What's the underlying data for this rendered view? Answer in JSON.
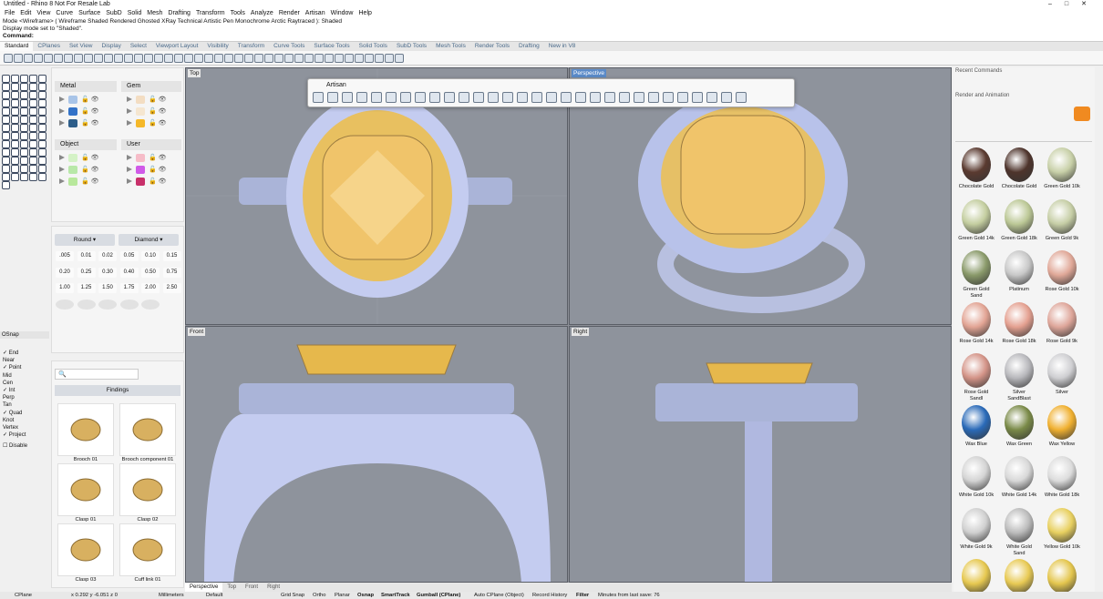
{
  "window": {
    "title": "Untitled - Rhino 8 Not For Resale Lab"
  },
  "menu": [
    "File",
    "Edit",
    "View",
    "Curve",
    "Surface",
    "SubD",
    "Solid",
    "Mesh",
    "Drafting",
    "Transform",
    "Tools",
    "Analyze",
    "Render",
    "Artisan",
    "Window",
    "Help"
  ],
  "command": {
    "line1": "Mode <Wireframe> ( Wireframe  Shaded  Rendered  Ghosted  XRay  Technical  Artistic  Pen  Monochrome  Arctic  Raytraced ): Shaded",
    "line2": "Display mode set to \"Shaded\".",
    "prompt": "Command:"
  },
  "tabs": [
    "Standard",
    "CPlanes",
    "Set View",
    "Display",
    "Select",
    "Viewport Layout",
    "Visibility",
    "Transform",
    "Curve Tools",
    "Surface Tools",
    "Solid Tools",
    "SubD Tools",
    "Mesh Tools",
    "Render Tools",
    "Drafting",
    "New in V8"
  ],
  "metal": {
    "label": "Metal",
    "colors": [
      "#a8c4e8",
      "#3272c8",
      "#2e5e8a"
    ]
  },
  "gem": {
    "label": "Gem",
    "colors": [
      "#f3ddc2",
      "#f5e6d0",
      "#f5b829"
    ]
  },
  "object": {
    "label": "Object",
    "colors": [
      "#d4f2c6",
      "#b8e8a8",
      "#b8e89c"
    ]
  },
  "user": {
    "label": "User",
    "colors": [
      "#f6bcc8",
      "#d05ae8",
      "#c8306a"
    ]
  },
  "shape": {
    "cut": "Round",
    "setting": "Diamond"
  },
  "sizes": [
    ".005",
    "0.01",
    "0.02",
    "0.05",
    "0.10",
    "0.15",
    "0.20",
    "0.25",
    "0.30",
    "0.40",
    "0.50",
    "0.75",
    "1.00",
    "1.25",
    "1.50",
    "1.75",
    "2.00",
    "2.50"
  ],
  "osnap": {
    "title": "OSnap",
    "items": [
      {
        "label": "End",
        "on": true
      },
      {
        "label": "Near",
        "on": false
      },
      {
        "label": "Point",
        "on": true
      },
      {
        "label": "Mid",
        "on": false
      },
      {
        "label": "Cen",
        "on": false
      },
      {
        "label": "Int",
        "on": true
      },
      {
        "label": "Perp",
        "on": false
      },
      {
        "label": "Tan",
        "on": false
      },
      {
        "label": "Quad",
        "on": true
      },
      {
        "label": "Knot",
        "on": false
      },
      {
        "label": "Vertex",
        "on": false
      },
      {
        "label": "Project",
        "on": true
      }
    ],
    "disable": "Disable"
  },
  "findings": {
    "header": "Findings",
    "items": [
      "Brooch 01",
      "Brooch component 01",
      "Clasp 01",
      "Clasp 02",
      "Clasp 03",
      "Cuff link 01"
    ]
  },
  "viewports": {
    "top": "Top",
    "perspective": "Perspective",
    "front": "Front",
    "right": "Right"
  },
  "artisan": {
    "title": "Artisan"
  },
  "vptabs": [
    "Perspective",
    "Top",
    "Front",
    "Right"
  ],
  "right": {
    "recent": "Recent Commands",
    "render": "Render and Animation"
  },
  "materials": [
    {
      "name": "Chocolate Gold",
      "color": "#5a3a30"
    },
    {
      "name": "Chocolate Gold",
      "color": "#4e342c"
    },
    {
      "name": "Green Gold 10k",
      "color": "#c8d0a8"
    },
    {
      "name": "Green Gold 14k",
      "color": "#c4cea0"
    },
    {
      "name": "Green Gold 18k",
      "color": "#bcc896"
    },
    {
      "name": "Green Gold 9k",
      "color": "#c6cea6"
    },
    {
      "name": "Green Gold Sand",
      "color": "#8a9a6a"
    },
    {
      "name": "Platinum",
      "color": "#c8c8c8"
    },
    {
      "name": "Rose Gold 10k",
      "color": "#e0a898"
    },
    {
      "name": "Rose Gold 14k",
      "color": "#e2a494"
    },
    {
      "name": "Rose Gold 18k",
      "color": "#e4a090"
    },
    {
      "name": "Rose Gold 9k",
      "color": "#dea69a"
    },
    {
      "name": "Rose Gold Sandl",
      "color": "#d49488"
    },
    {
      "name": "Silver SandBlast",
      "color": "#b8b8bc"
    },
    {
      "name": "Silver",
      "color": "#cfcfd2"
    },
    {
      "name": "Wax Blue",
      "color": "#2a6ab8"
    },
    {
      "name": "Wax Green",
      "color": "#7a8a48"
    },
    {
      "name": "Wax Yellow",
      "color": "#f0b030"
    },
    {
      "name": "White Gold 10k",
      "color": "#d4d4d4"
    },
    {
      "name": "White Gold 14k",
      "color": "#d8d8d8"
    },
    {
      "name": "White Gold 18k",
      "color": "#dcdcdc"
    },
    {
      "name": "White Gold 9k",
      "color": "#d0d0d0"
    },
    {
      "name": "White Gold Sand",
      "color": "#bcbcbc"
    },
    {
      "name": "Yellow Gold 10k",
      "color": "#e8d060"
    },
    {
      "name": "",
      "color": "#e6c850"
    },
    {
      "name": "",
      "color": "#e8ca54"
    },
    {
      "name": "",
      "color": "#e4c64e"
    }
  ],
  "status": {
    "cplane": "CPlane",
    "coords": "x 0.292  y -6.051  z 0",
    "units": "Millimeters",
    "layer": "Default",
    "gridsnap": "Grid Snap",
    "ortho": "Ortho",
    "planar": "Planar",
    "osnap": "Osnap",
    "smarttrack": "SmartTrack",
    "gumball": "Gumball (CPlane)",
    "autocplane": "Auto CPlane (Object)",
    "history": "Record History",
    "filter": "Filter",
    "minutes": "Minutes from last save: 76"
  }
}
